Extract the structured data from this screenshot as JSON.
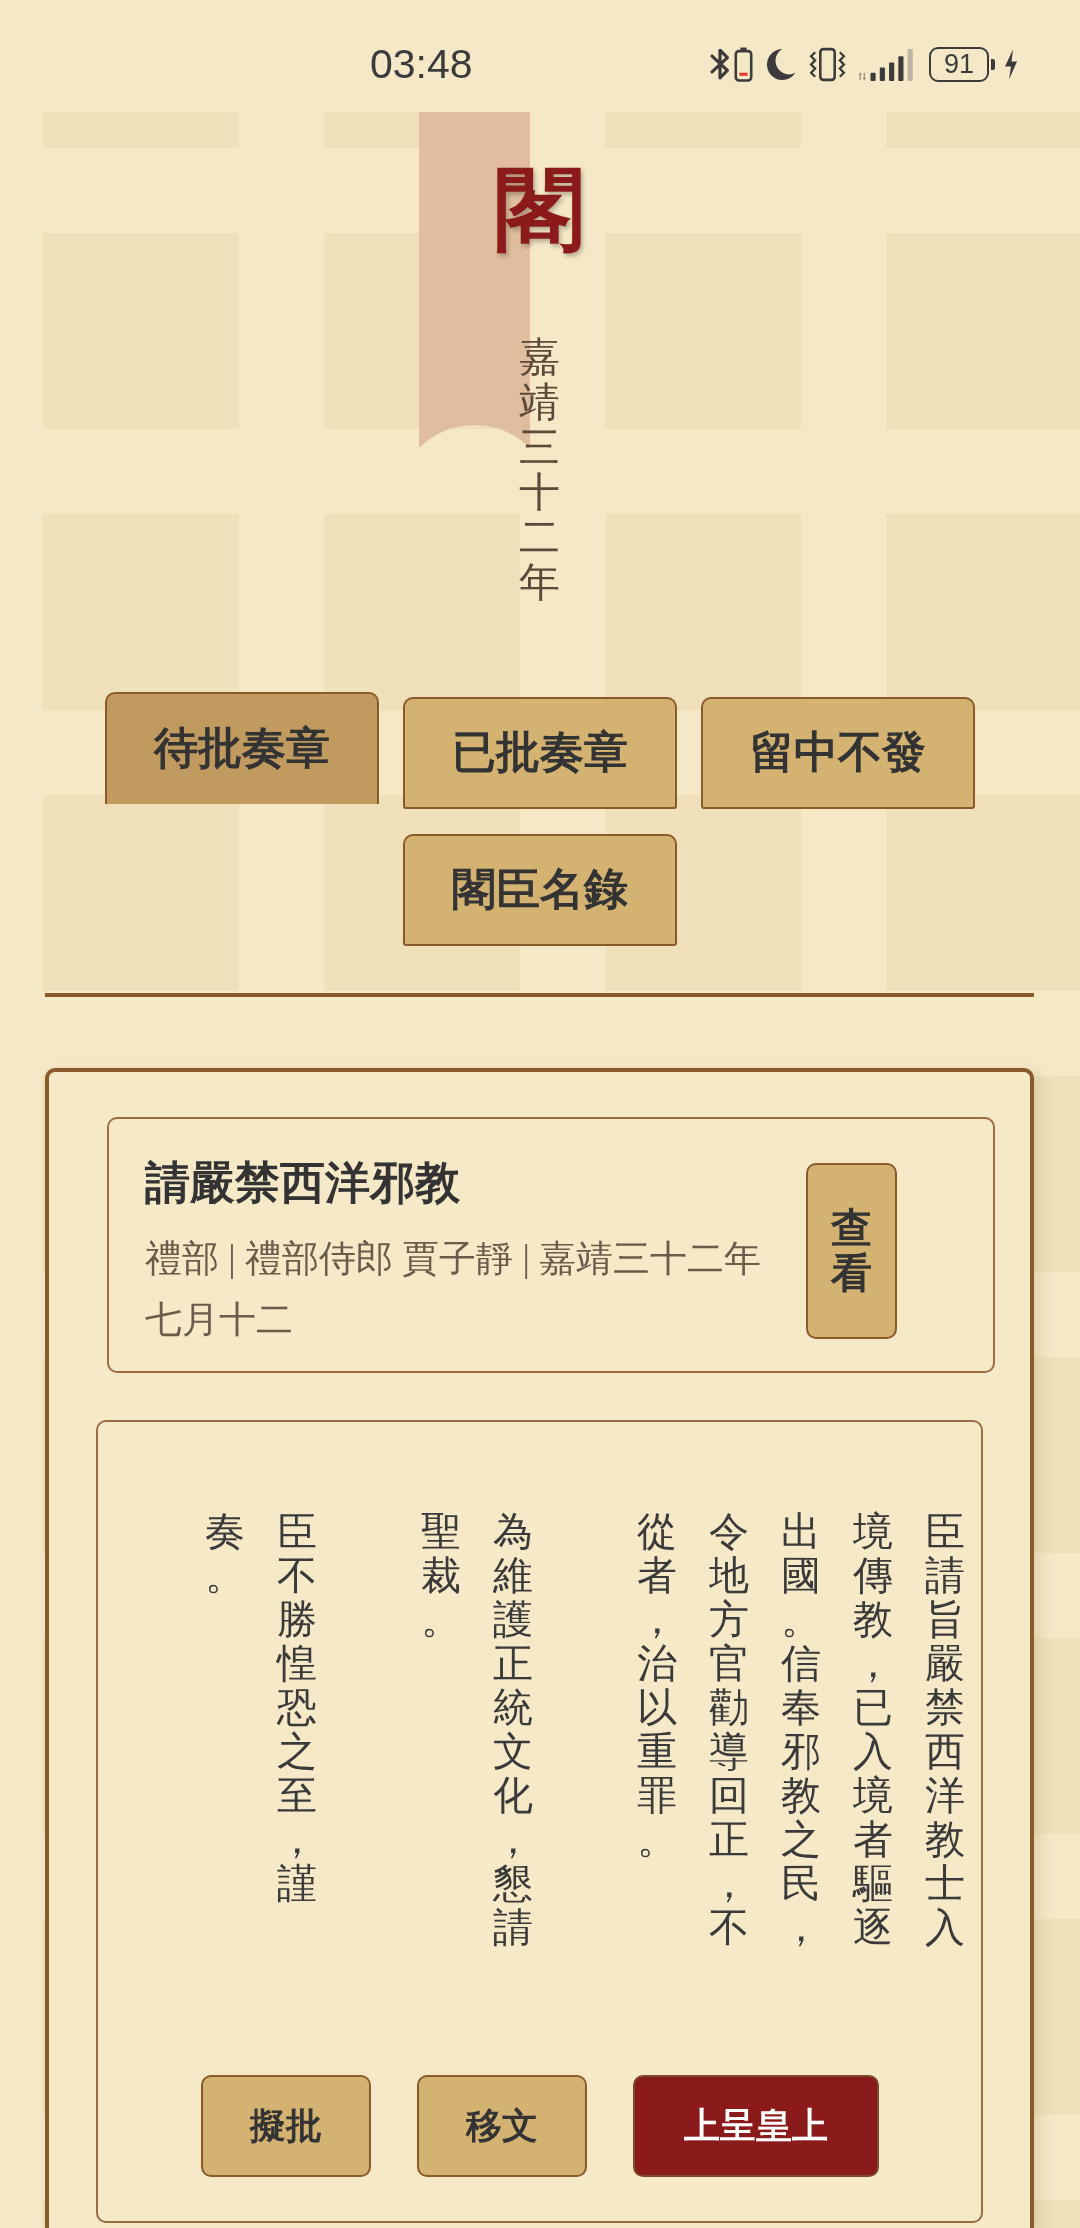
{
  "status_bar": {
    "time": "03:48",
    "battery": "91"
  },
  "header": {
    "title": "閣",
    "subtitle": "嘉靖三十二年"
  },
  "tabs": [
    {
      "label": "待批奏章",
      "selected": true
    },
    {
      "label": "已批奏章",
      "selected": false
    },
    {
      "label": "留中不發",
      "selected": false
    },
    {
      "label": "閣臣名錄",
      "selected": false
    }
  ],
  "memorial": {
    "title": "請嚴禁西洋邪教",
    "meta": "禮部 | 禮部侍郎 賈子靜 | 嘉靖三十二年七月十二",
    "view_button": "查看"
  },
  "document": {
    "paragraph_1": "臣請旨嚴禁西洋教士入境傳教，已入境者驅逐出國。信奉邪教之民，令地方官勸導回正，不從者，治以重罪。",
    "paragraph_2": "為維護正統文化，懇請聖裁。",
    "paragraph_3": "臣不勝惶恐之至，謹奏。"
  },
  "actions": [
    {
      "label": "擬批",
      "kind": "secondary"
    },
    {
      "label": "移文",
      "kind": "secondary"
    },
    {
      "label": "上呈皇上",
      "kind": "primary"
    }
  ]
}
